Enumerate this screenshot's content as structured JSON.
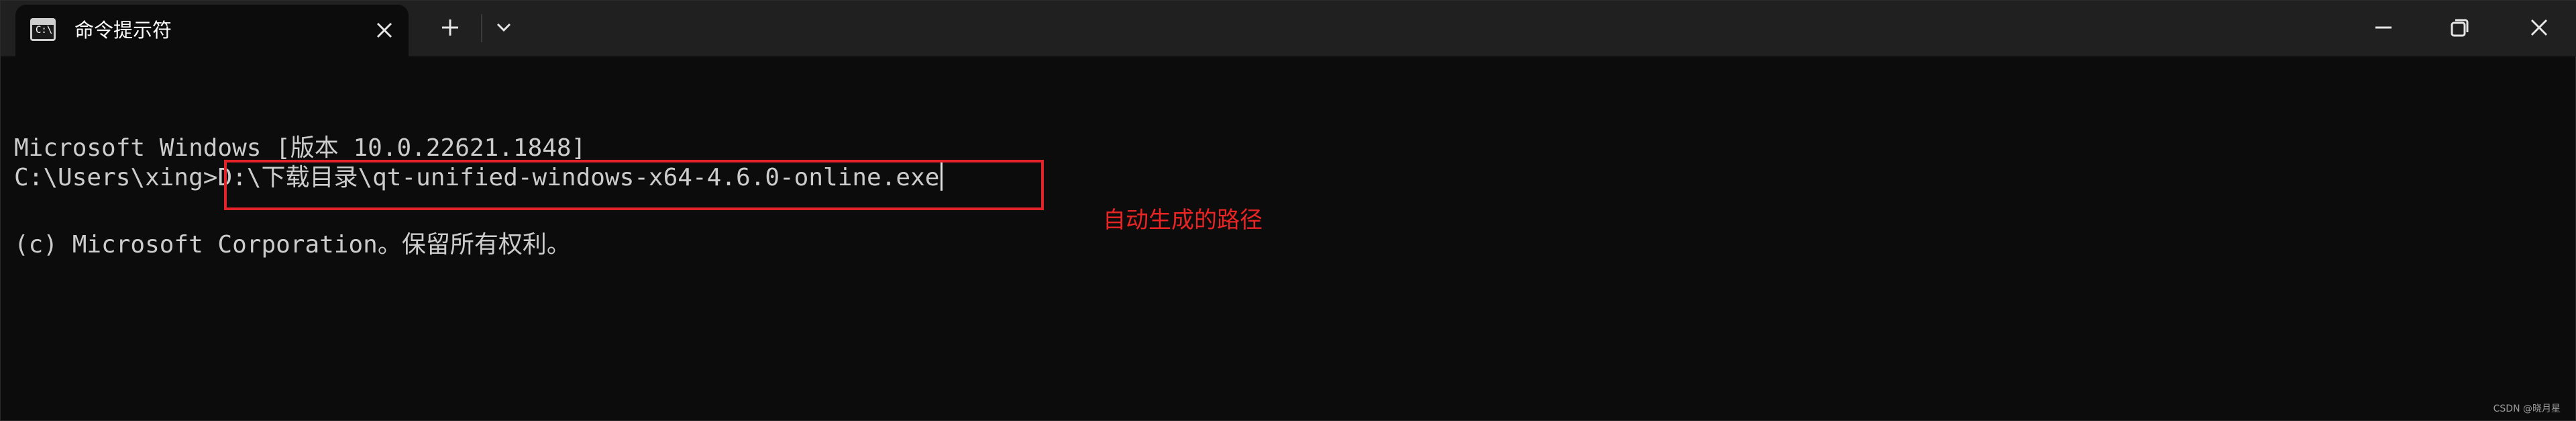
{
  "app": {
    "tab_title": "命令提示符",
    "icon_name": "terminal-icon",
    "icon_prompt": "C:\\"
  },
  "titlebar": {
    "new_tab_icon": "plus-icon",
    "dropdown_icon": "chevron-down-icon",
    "minimize_icon": "minimize-icon",
    "maximize_icon": "restore-icon",
    "close_icon": "close-icon"
  },
  "terminal": {
    "lines": [
      "Microsoft Windows [版本 10.0.22621.1848]",
      "(c) Microsoft Corporation。保留所有权利。"
    ],
    "prompt": "C:\\Users\\xing>",
    "command": "D:\\下载目录\\qt-unified-windows-x64-4.6.0-online.exe"
  },
  "annotation": {
    "text": "自动生成的路径",
    "color": "#e52229"
  },
  "watermark": "CSDN @晓月星",
  "colors": {
    "background": "#0c0c0c",
    "titlebar": "#202020",
    "text": "#cccccc",
    "highlight": "#e52229"
  }
}
